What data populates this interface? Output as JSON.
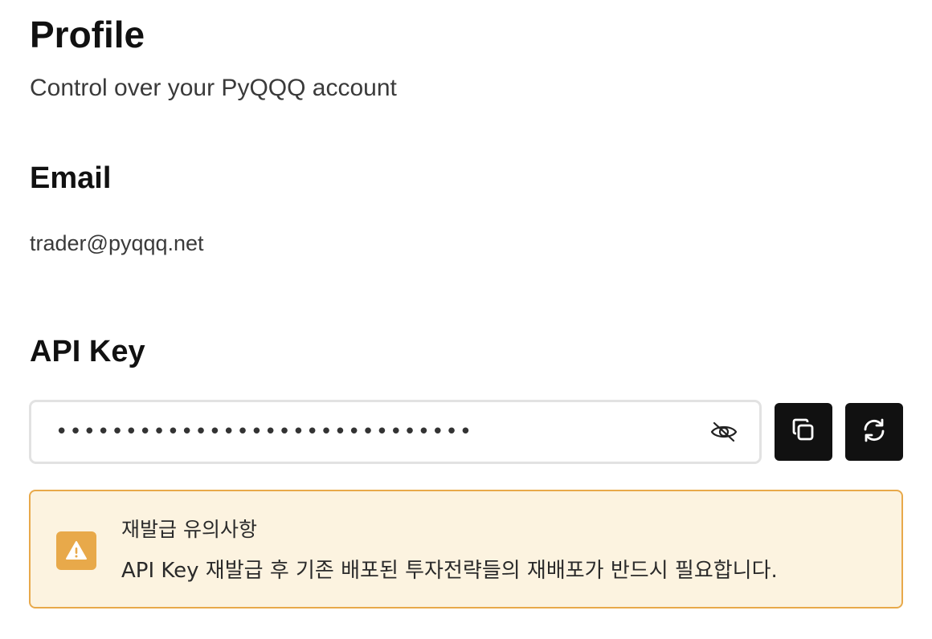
{
  "header": {
    "title": "Profile",
    "subtitle": "Control over your PyQQQ account"
  },
  "email": {
    "heading": "Email",
    "value": "trader@pyqqq.net"
  },
  "api_key": {
    "heading": "API Key",
    "masked_value": "••••••••••••••••••••••••••••••",
    "icons": {
      "visibility": "eye-off-icon",
      "copy": "copy-icon",
      "regenerate": "refresh-icon"
    }
  },
  "notice": {
    "icon": "warning-icon",
    "title": "재발급 유의사항",
    "text": "API Key 재발급 후 기존 배포된 투자전략들의 재배포가 반드시 필요합니다."
  },
  "colors": {
    "button_bg": "#111111",
    "notice_bg": "#fcf3e0",
    "notice_border": "#e8a94a",
    "field_border": "#e2e2e2"
  }
}
